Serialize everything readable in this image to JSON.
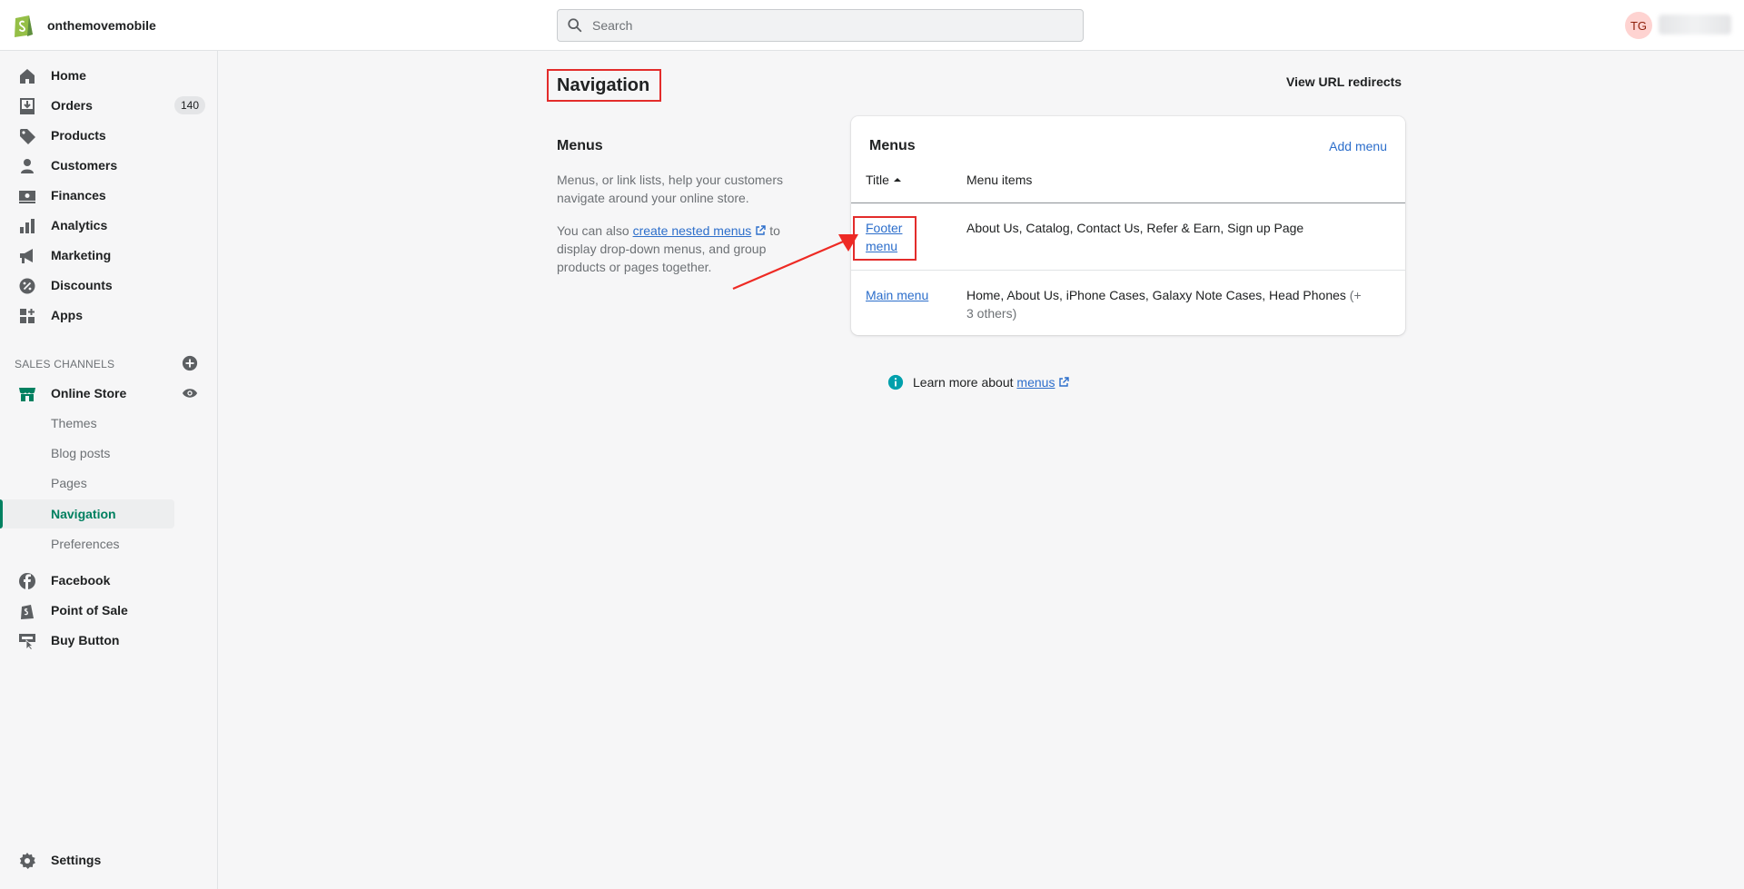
{
  "topbar": {
    "store_name": "onthemovemobile",
    "search_placeholder": "Search",
    "user_initials": "TG"
  },
  "sidebar": {
    "items": [
      {
        "label": "Home",
        "icon": "home-icon"
      },
      {
        "label": "Orders",
        "icon": "orders-icon",
        "badge": "140"
      },
      {
        "label": "Products",
        "icon": "tag-icon"
      },
      {
        "label": "Customers",
        "icon": "person-icon"
      },
      {
        "label": "Finances",
        "icon": "finances-icon"
      },
      {
        "label": "Analytics",
        "icon": "bar-chart-icon"
      },
      {
        "label": "Marketing",
        "icon": "megaphone-icon"
      },
      {
        "label": "Discounts",
        "icon": "discount-icon"
      },
      {
        "label": "Apps",
        "icon": "apps-icon"
      }
    ],
    "sales_channels_title": "SALES CHANNELS",
    "online_store": {
      "label": "Online Store",
      "sub_items": [
        "Themes",
        "Blog posts",
        "Pages",
        "Navigation",
        "Preferences"
      ],
      "active": "Navigation"
    },
    "channels": [
      {
        "label": "Facebook",
        "icon": "facebook-icon"
      },
      {
        "label": "Point of Sale",
        "icon": "point-of-sale-icon"
      },
      {
        "label": "Buy Button",
        "icon": "buy-button-icon"
      }
    ],
    "settings_label": "Settings"
  },
  "page": {
    "title": "Navigation",
    "view_url_redirects": "View URL redirects"
  },
  "annotation": {
    "title": "Menus",
    "desc1": "Menus, or link lists, help your customers navigate around your online store.",
    "desc2_prefix": "You can also",
    "desc2_link": "create nested menus",
    "desc2_suffix": "to display drop-down menus, and group products or pages together."
  },
  "menus_card": {
    "title": "Menus",
    "add_menu": "Add menu",
    "col_title": "Title",
    "col_items": "Menu items",
    "rows": [
      {
        "title": "Footer menu",
        "items": "About Us, Catalog, Contact Us, Refer & Earn, Sign up Page"
      },
      {
        "title": "Main menu",
        "items": "Home, About Us, iPhone Cases, Galaxy Note Cases, Head Phones",
        "more": "(+ 3 others)"
      }
    ]
  },
  "learn_more": {
    "prefix": "Learn more about",
    "link": "menus"
  },
  "colors": {
    "accent_green": "#008060",
    "link_blue": "#2c6ecb",
    "highlight_red": "#e32c2b",
    "shopify_green": "#95bf47"
  }
}
